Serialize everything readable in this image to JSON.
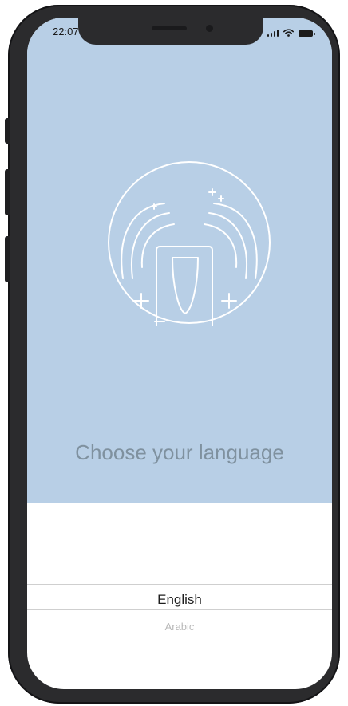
{
  "status_bar": {
    "time": "22:07",
    "icons": [
      "signal-icon",
      "wifi-icon",
      "battery-icon"
    ]
  },
  "hero": {
    "background_color": "#b8cfe6",
    "logo_icon": "fountain-logo-icon"
  },
  "title": "Choose your language",
  "language_picker": {
    "options": [
      "English",
      "Arabic"
    ],
    "selected": "English"
  },
  "colors": {
    "title": "#7f919f",
    "selected_option": "#1e1e1e",
    "unselected_option": "#b9b9b9"
  }
}
